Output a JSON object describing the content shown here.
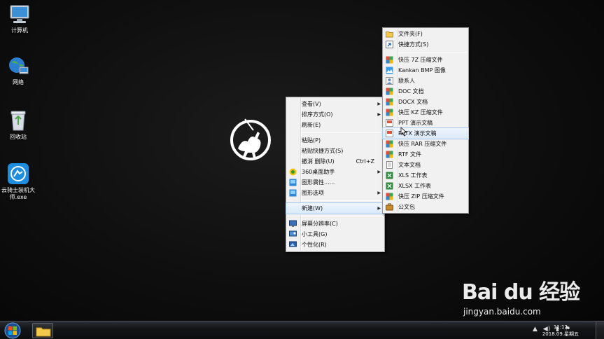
{
  "desktop": {
    "icons": [
      {
        "label": "计算机",
        "icon": "computer-icon"
      },
      {
        "label": "网络",
        "icon": "network-icon"
      },
      {
        "label": "回收站",
        "icon": "recycle-bin-icon"
      },
      {
        "label": "云骑士装机大师.exe",
        "icon": "app-icon"
      }
    ]
  },
  "context_menu": {
    "items": [
      {
        "label": "查看(V)",
        "submenu": true
      },
      {
        "label": "排序方式(O)",
        "submenu": true
      },
      {
        "label": "刷新(E)"
      },
      {
        "separator": true
      },
      {
        "label": "粘贴(P)"
      },
      {
        "label": "粘贴快捷方式(S)"
      },
      {
        "label": "撤消 删除(U)",
        "shortcut": "Ctrl+Z"
      },
      {
        "label": "360桌面助手",
        "submenu": true,
        "icon": "360-icon"
      },
      {
        "label": "图形属性......",
        "icon": "graphics-icon"
      },
      {
        "label": "图形选项",
        "submenu": true,
        "icon": "graphics-icon"
      },
      {
        "separator": true
      },
      {
        "label": "新建(W)",
        "submenu": true,
        "highlighted": true
      },
      {
        "separator": true
      },
      {
        "label": "屏幕分辨率(C)",
        "icon": "screen-icon"
      },
      {
        "label": "小工具(G)",
        "icon": "gadget-icon"
      },
      {
        "label": "个性化(R)",
        "icon": "personalize-icon"
      }
    ]
  },
  "new_submenu": {
    "items": [
      {
        "label": "文件夹(F)",
        "icon": "folder-icon"
      },
      {
        "label": "快捷方式(S)",
        "icon": "shortcut-icon"
      },
      {
        "separator": true
      },
      {
        "label": "快压 7Z 压缩文件",
        "icon": "archive-icon"
      },
      {
        "label": "Kankan BMP 图像",
        "icon": "image-icon"
      },
      {
        "label": "联系人",
        "icon": "contact-icon"
      },
      {
        "label": "DOC 文档",
        "icon": "doc-icon"
      },
      {
        "label": "DOCX 文档",
        "icon": "doc-icon"
      },
      {
        "label": "快压 KZ 压缩文件",
        "icon": "archive-icon"
      },
      {
        "label": "PPT 演示文稿",
        "icon": "ppt-icon"
      },
      {
        "label": "PPTX 演示文稿",
        "icon": "ppt-icon",
        "highlighted": true
      },
      {
        "label": "快压 RAR 压缩文件",
        "icon": "archive-icon"
      },
      {
        "label": "RTF 文件",
        "icon": "rtf-icon"
      },
      {
        "label": "文本文档",
        "icon": "text-icon"
      },
      {
        "label": "XLS 工作表",
        "icon": "xls-icon"
      },
      {
        "label": "XLSX 工作表",
        "icon": "xls-icon"
      },
      {
        "label": "快压 ZIP 压缩文件",
        "icon": "archive-icon"
      },
      {
        "label": "公文包",
        "icon": "briefcase-icon"
      }
    ]
  },
  "taskbar": {
    "clock_time": "11:12",
    "clock_date": "2018.09.星期五"
  },
  "watermark": {
    "brand": "Bai du 经验",
    "url": "jingyan.baidu.com"
  },
  "colors": {
    "menu_bg": "#f1f1f1",
    "highlight": "#dbe9fa",
    "desktop_bg": "#0e0e0e"
  }
}
